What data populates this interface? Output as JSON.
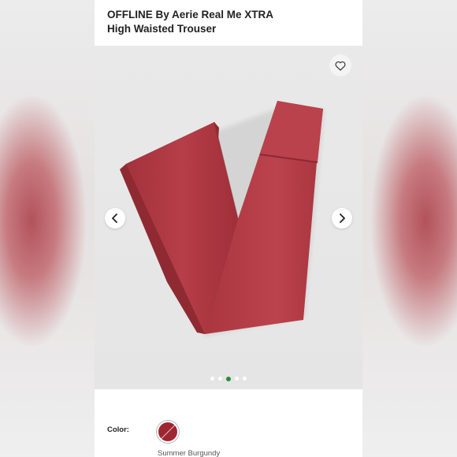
{
  "product": {
    "title_line1": "OFFLINE By Aerie Real Me XTRA",
    "title_line2": "High Waisted Trouser"
  },
  "gallery": {
    "favorite_icon": "heart-icon",
    "prev_icon": "chevron-left-icon",
    "next_icon": "chevron-right-icon",
    "dot_count": 5,
    "active_dot": 2,
    "product_color": "#b03a44"
  },
  "color_section": {
    "label": "Color:",
    "selected_name": "Summer Burgundy",
    "swatch_color": "#9e2631"
  },
  "colors": {
    "accent": "#2b8a3e",
    "text": "#222222"
  }
}
